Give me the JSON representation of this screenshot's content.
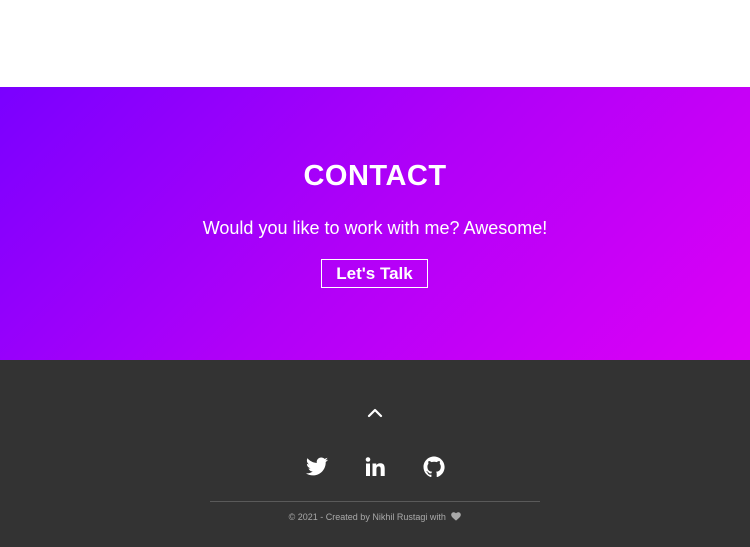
{
  "contact": {
    "title": "CONTACT",
    "subtitle": "Would you like to work with me? Awesome!",
    "button_label": "Let's Talk"
  },
  "footer": {
    "scroll_top_icon": "chevron-up-icon",
    "social": [
      {
        "icon": "twitter-icon"
      },
      {
        "icon": "linkedin-icon"
      },
      {
        "icon": "github-icon"
      }
    ],
    "copyright": "© 2021 - Created by Nikhil Rustagi with",
    "heart_icon": "heart-icon"
  },
  "colors": {
    "gradient_start": "#7a00ff",
    "gradient_end": "#dd00f6",
    "footer_bg": "#333333"
  }
}
